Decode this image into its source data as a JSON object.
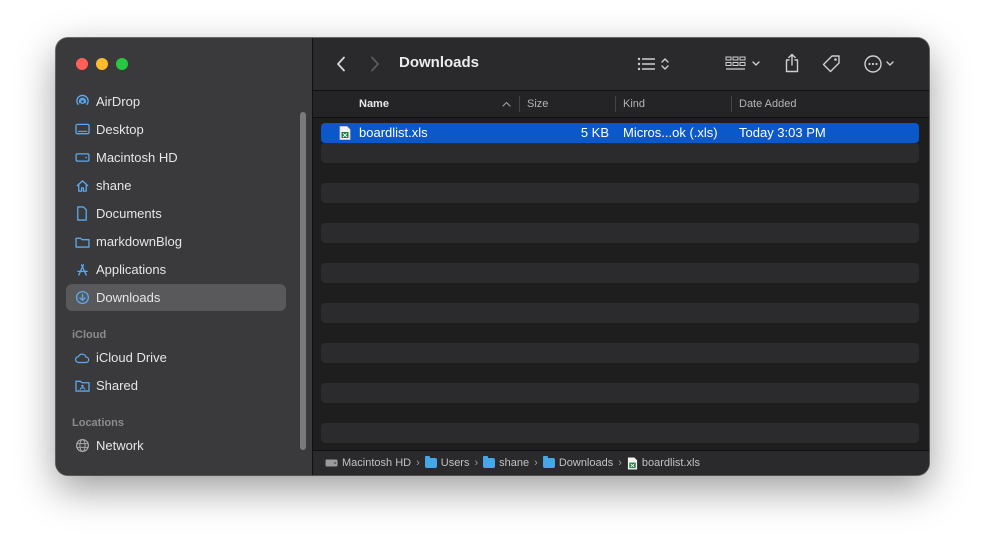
{
  "window": {
    "title": "Downloads"
  },
  "sidebar": {
    "favorites": [
      {
        "label": "AirDrop",
        "icon": "airdrop-icon"
      },
      {
        "label": "Desktop",
        "icon": "desktop-icon"
      },
      {
        "label": "Macintosh HD",
        "icon": "drive-icon"
      },
      {
        "label": "shane",
        "icon": "home-icon"
      },
      {
        "label": "Documents",
        "icon": "document-icon"
      },
      {
        "label": "markdownBlog",
        "icon": "folder-icon"
      },
      {
        "label": "Applications",
        "icon": "applications-icon"
      },
      {
        "label": "Downloads",
        "icon": "downloads-icon",
        "selected": true
      }
    ],
    "icloud_header": "iCloud",
    "icloud": [
      {
        "label": "iCloud Drive",
        "icon": "cloud-icon"
      },
      {
        "label": "Shared",
        "icon": "shared-folder-icon"
      }
    ],
    "locations_header": "Locations",
    "locations": [
      {
        "label": "Network",
        "icon": "network-icon"
      }
    ]
  },
  "columns": {
    "name": "Name",
    "size": "Size",
    "kind": "Kind",
    "date_added": "Date Added"
  },
  "files": [
    {
      "name": "boardlist.xls",
      "size": "5 KB",
      "kind": "Micros...ok (.xls)",
      "date_added": "Today 3:03 PM",
      "icon": "excel-file-icon"
    }
  ],
  "pathbar": [
    {
      "label": "Macintosh HD",
      "icon": "drive-icon"
    },
    {
      "label": "Users",
      "icon": "folder-icon"
    },
    {
      "label": "shane",
      "icon": "folder-icon"
    },
    {
      "label": "Downloads",
      "icon": "folder-icon"
    },
    {
      "label": "boardlist.xls",
      "icon": "excel-file-icon"
    }
  ],
  "pathbar_separator": "›",
  "colors": {
    "accent": "#0a58ca",
    "sidebar_bg": "#3a3a3c",
    "content_bg": "#1e1e1e"
  }
}
